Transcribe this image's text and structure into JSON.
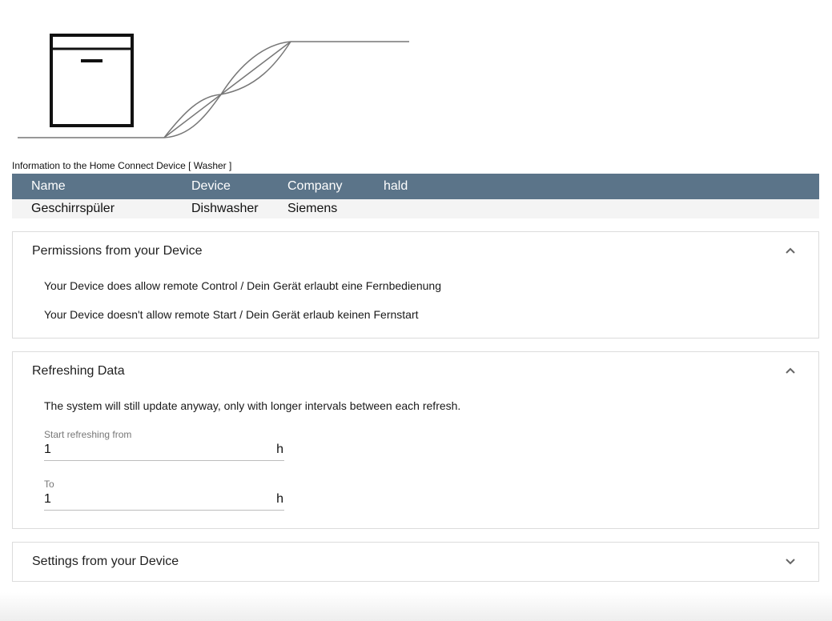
{
  "header": {
    "caption": "Information to the Home Connect Device [ Washer ]"
  },
  "table": {
    "columns": [
      "Name",
      "Device",
      "Company",
      "hald"
    ],
    "rows": [
      [
        "Geschirrspüler",
        "Dishwasher",
        "Siemens",
        ""
      ]
    ]
  },
  "permissions": {
    "title": "Permissions from your Device",
    "expanded": true,
    "lines": [
      "Your Device does allow remote Control / Dein Gerät erlaubt eine Fernbedienung",
      "Your Device doesn't allow remote Start / Dein Gerät erlaub keinen Fernstart"
    ]
  },
  "refreshing": {
    "title": "Refreshing Data",
    "expanded": true,
    "description": "The system will still update anyway, only with longer intervals between each refresh.",
    "from": {
      "label": "Start refreshing from",
      "value": "1",
      "suffix": "h"
    },
    "to": {
      "label": "To",
      "value": "1",
      "suffix": "h"
    }
  },
  "settings": {
    "title": "Settings from your Device",
    "expanded": false
  },
  "icons": {
    "device": "dishwasher-icon",
    "expand_less": "chevron-up-icon",
    "expand_more": "chevron-down-icon"
  },
  "colors": {
    "table_header": "#5b7489",
    "table_row": "#f4f4f4",
    "panel_border": "#dcdcdc"
  }
}
